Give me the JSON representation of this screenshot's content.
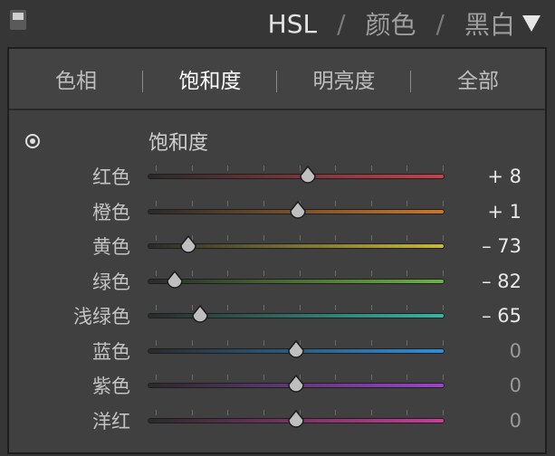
{
  "header": {
    "tabs": [
      "HSL",
      "颜色",
      "黑白"
    ],
    "active_tab": "HSL",
    "separator": "/",
    "dropdown_icon": "triangle-down-icon"
  },
  "subtabs": {
    "items": [
      "色相",
      "饱和度",
      "明亮度",
      "全部"
    ],
    "active": "饱和度"
  },
  "section": {
    "title": "饱和度",
    "target_icon": "target-adjust-icon"
  },
  "sliders": {
    "range": [
      -100,
      100
    ],
    "rows": [
      {
        "label": "红色",
        "value": 8,
        "display": "+ 8",
        "color_left": "#2a2a2a",
        "color_right": "#c8404a"
      },
      {
        "label": "橙色",
        "value": 1,
        "display": "+ 1",
        "color_left": "#2a2a2a",
        "color_right": "#c8782e"
      },
      {
        "label": "黄色",
        "value": -73,
        "display": "– 73",
        "color_left": "#2a2a2a",
        "color_right": "#c8b83a"
      },
      {
        "label": "绿色",
        "value": -82,
        "display": "– 82",
        "color_left": "#2a2a2a",
        "color_right": "#6ab43c"
      },
      {
        "label": "浅绿色",
        "value": -65,
        "display": "– 65",
        "color_left": "#2a2a2a",
        "color_right": "#2fb8a6"
      },
      {
        "label": "蓝色",
        "value": 0,
        "display": "0",
        "color_left": "#2a2a2a",
        "color_right": "#2f8ed8"
      },
      {
        "label": "紫色",
        "value": 0,
        "display": "0",
        "color_left": "#2a2a2a",
        "color_right": "#9a46c8"
      },
      {
        "label": "洋红",
        "value": 0,
        "display": "0",
        "color_left": "#2a2a2a",
        "color_right": "#c83e9a"
      }
    ]
  }
}
